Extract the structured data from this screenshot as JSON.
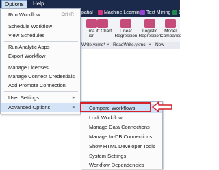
{
  "menubar": {
    "options_label": "Options",
    "help_label": "Help"
  },
  "ribbon_tabs": [
    {
      "label": "patial"
    },
    {
      "label": "Machine Learning",
      "color": "#d6317a"
    },
    {
      "label": "Text Mining",
      "color": "#9b3fd6"
    },
    {
      "label": "C",
      "color": "#1e8a50"
    }
  ],
  "ribbon_tools": [
    {
      "label": "ma\nion",
      "icon": "chart-icon",
      "color": "#c44b7a"
    },
    {
      "label": "Lift Chart",
      "icon": "lift-chart-icon",
      "color": "#c44b7a"
    },
    {
      "label": "Linear\nRegression",
      "icon": "linear-regression-icon",
      "color": "#c44b7a"
    },
    {
      "label": "Logistic\nRegression",
      "icon": "logistic-regression-icon",
      "color": "#c44b7a"
    },
    {
      "label": "Model\nCompariso",
      "icon": "model-comparison-icon",
      "color": "#c44b7a"
    }
  ],
  "doc_tabs": [
    {
      "label": "Write.yxmd*"
    },
    {
      "label": "ReadWrite.yxmc"
    },
    {
      "label": "New Workflow"
    }
  ],
  "options_menu": [
    {
      "label": "Run Workflow",
      "shortcut": "Ctrl+R"
    },
    {
      "label": "Schedule Workflow"
    },
    {
      "label": "View Schedules"
    },
    {
      "label": "Run Analytic Apps"
    },
    {
      "label": "Export Workflow"
    },
    {
      "label": "Manage Licenses"
    },
    {
      "label": "Manage Connect Credentials"
    },
    {
      "label": "Add Promote Connection"
    },
    {
      "label": "User Settings"
    },
    {
      "label": "Advanced Options"
    }
  ],
  "advanced_submenu": [
    {
      "label": "Compare Workflows"
    },
    {
      "label": "Lock Workflow"
    },
    {
      "label": "Manage Data Connections"
    },
    {
      "label": "Manage In-DB Connections"
    },
    {
      "label": "Show HTML Developer Tools"
    },
    {
      "label": "System Settings"
    },
    {
      "label": "Workflow Dependencies"
    }
  ],
  "colors": {
    "menubar_bg": "#1b2a4a",
    "highlight": "#cde0f7",
    "annotation": "#d8202a"
  }
}
